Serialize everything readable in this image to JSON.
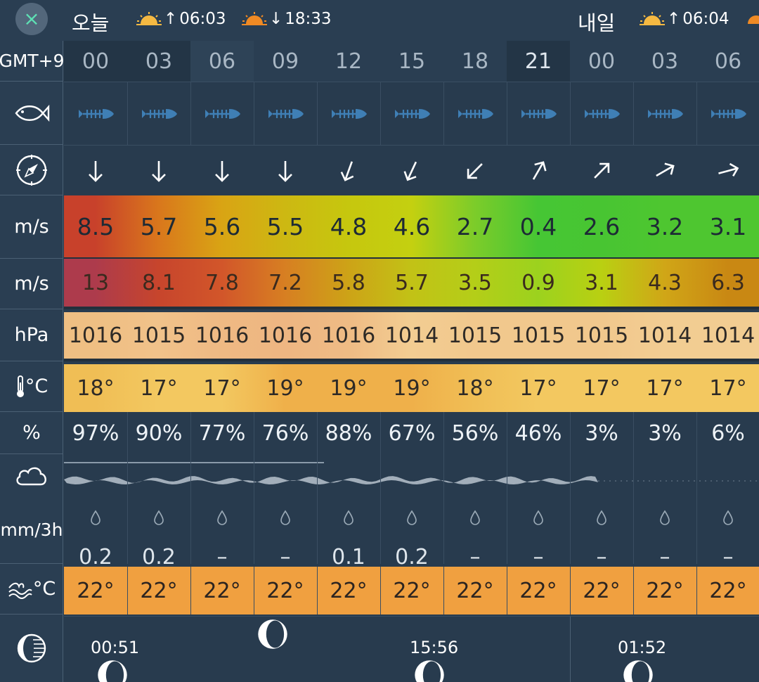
{
  "header": {
    "close_icon": "×",
    "today": "오늘",
    "tomorrow": "내일",
    "today_sunrise": "06:03",
    "today_sunset": "18:33",
    "tomorrow_sunrise": "06:04"
  },
  "labels": {
    "timezone": "GMT+9",
    "wind_unit": "m/s",
    "gust_unit": "m/s",
    "pressure_unit": "hPa",
    "temp_unit": "°C",
    "humidity_unit": "%",
    "precip_unit": "mm/3h",
    "sea_temp_unit": "°C"
  },
  "hours": [
    "00",
    "03",
    "06",
    "09",
    "12",
    "15",
    "18",
    "21",
    "00",
    "03",
    "06"
  ],
  "wind_speed": [
    "8.5",
    "5.7",
    "5.6",
    "5.5",
    "4.8",
    "4.6",
    "2.7",
    "0.4",
    "2.6",
    "3.2",
    "3.1"
  ],
  "wind_gust": [
    "13",
    "8.1",
    "7.8",
    "7.2",
    "5.8",
    "5.7",
    "3.5",
    "0.9",
    "3.1",
    "4.3",
    "6.3"
  ],
  "wind_dir_deg": [
    180,
    180,
    180,
    180,
    200,
    205,
    225,
    30,
    45,
    60,
    75
  ],
  "pressure": [
    "1016",
    "1015",
    "1016",
    "1016",
    "1016",
    "1014",
    "1015",
    "1015",
    "1015",
    "1014",
    "1014"
  ],
  "temperature": [
    "18°",
    "17°",
    "17°",
    "19°",
    "19°",
    "19°",
    "18°",
    "17°",
    "17°",
    "17°",
    "17°"
  ],
  "humidity": [
    "97%",
    "90%",
    "77%",
    "76%",
    "88%",
    "67%",
    "56%",
    "46%",
    "3%",
    "3%",
    "6%"
  ],
  "precipitation": [
    "0.2",
    "0.2",
    "–",
    "–",
    "0.1",
    "0.2",
    "–",
    "–",
    "–",
    "–",
    "–"
  ],
  "sea_temp": [
    "22°",
    "22°",
    "22°",
    "22°",
    "22°",
    "22°",
    "22°",
    "22°",
    "22°",
    "22°",
    "22°"
  ],
  "moon": {
    "times": [
      "00:51",
      "15:56",
      "01:52"
    ]
  },
  "colors": {
    "background": "#283b4e",
    "accent": "#5ee0b4",
    "sun": "#f5b942",
    "sea_row": "#f0a040"
  }
}
